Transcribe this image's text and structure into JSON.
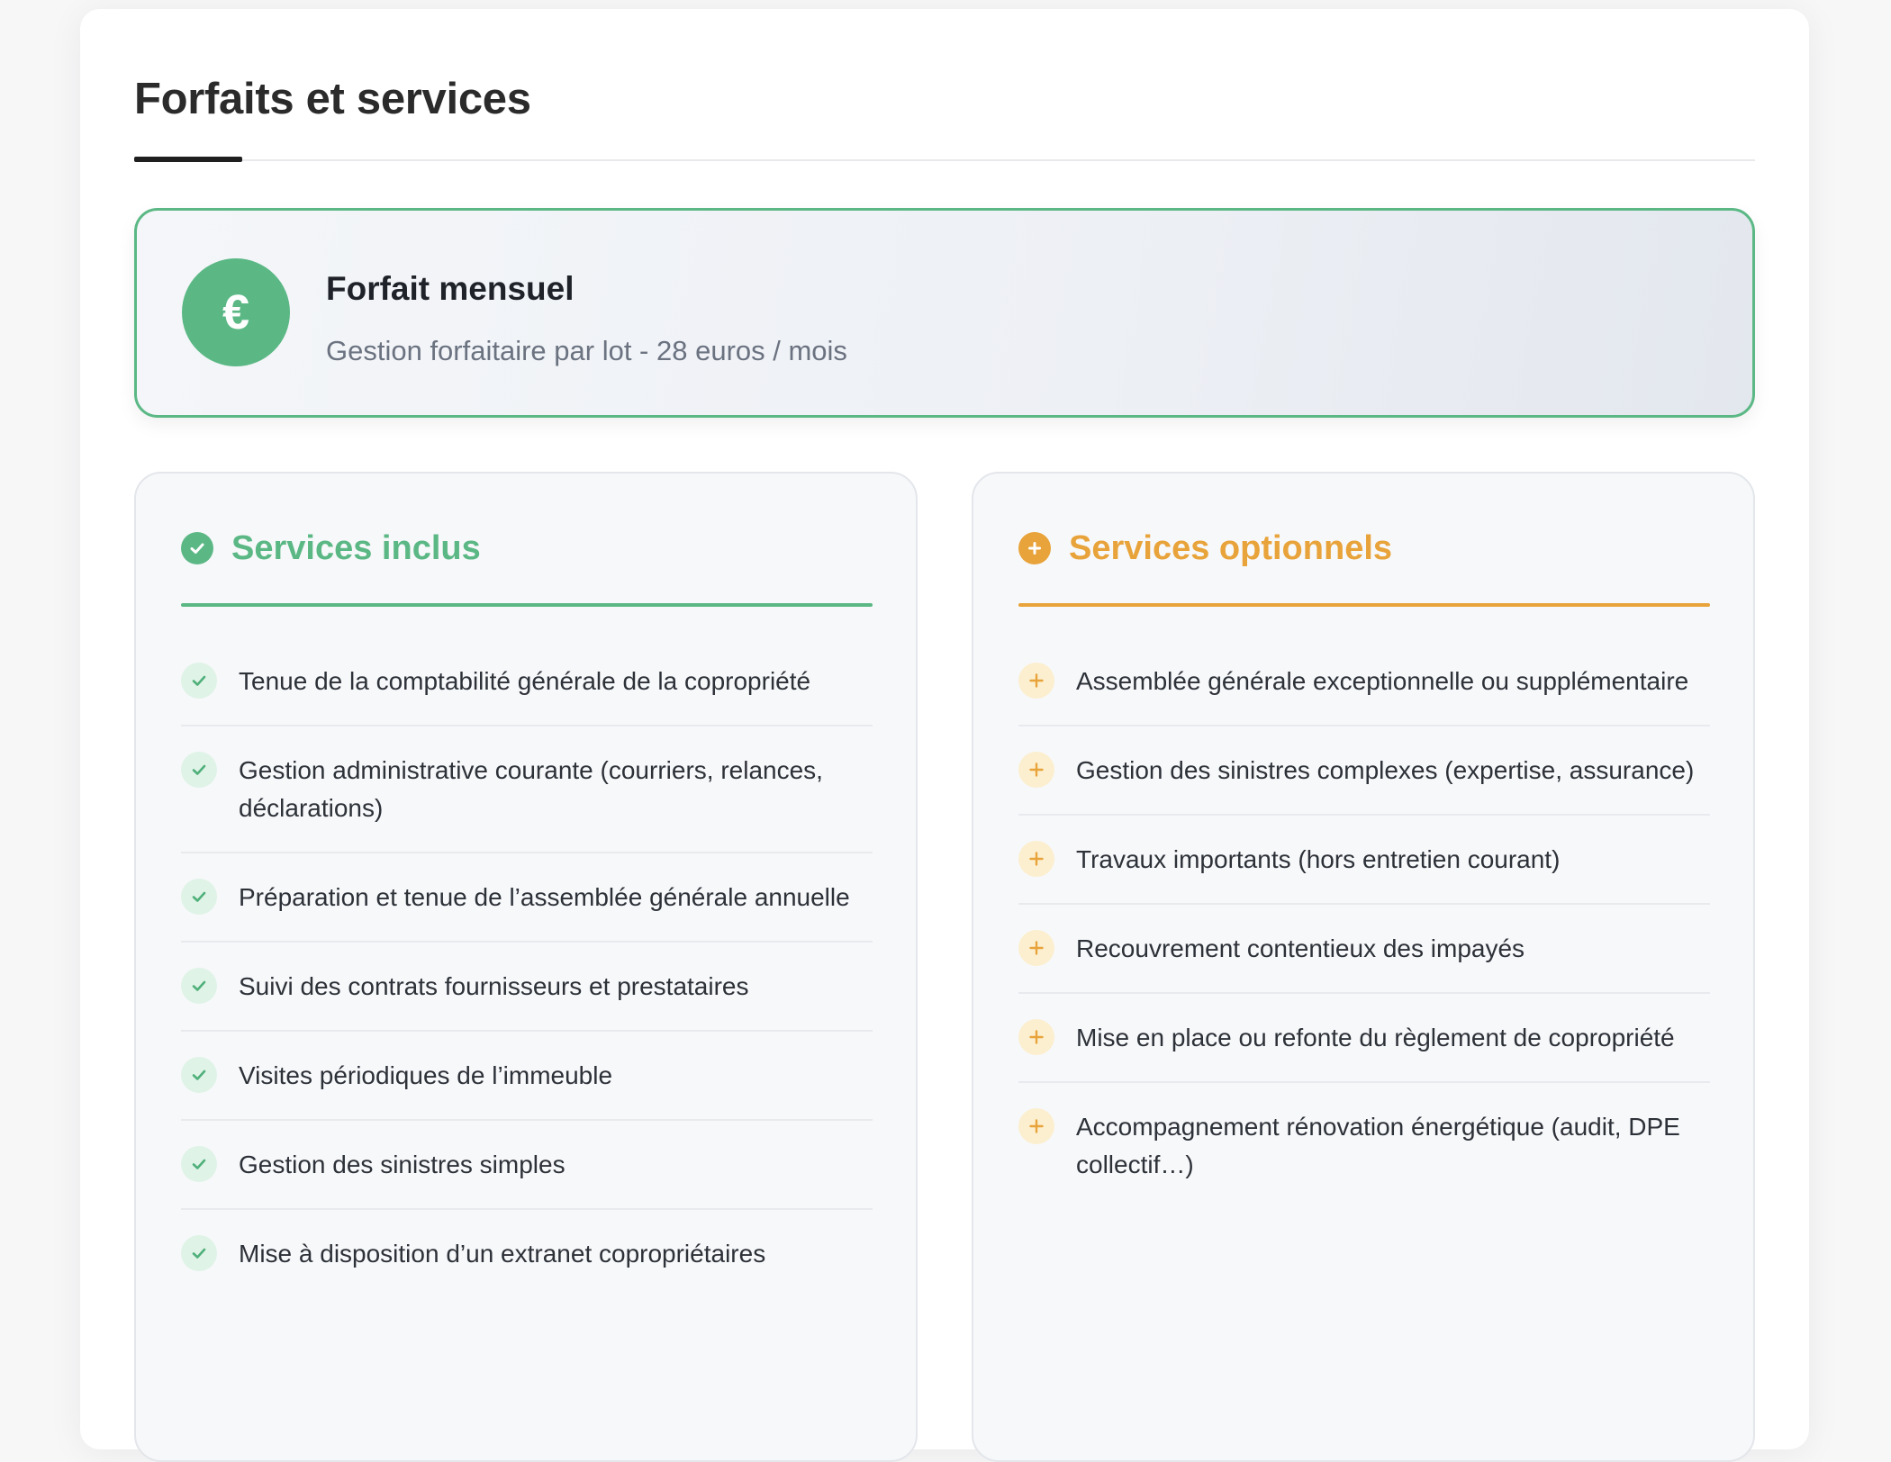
{
  "page": {
    "title": "Forfaits et services"
  },
  "forfait": {
    "icon": "euro-icon",
    "symbol": "€",
    "title": "Forfait mensuel",
    "subtitle": "Gestion forfaitaire par lot - 28 euros / mois",
    "accent_color": "#5bb885"
  },
  "included": {
    "icon": "check-circle-icon",
    "title": "Services inclus",
    "color": "#5bb885",
    "items": [
      {
        "icon": "check-icon",
        "label": "Tenue de la comptabilité générale de la copropriété"
      },
      {
        "icon": "check-icon",
        "label": "Gestion administrative courante (courriers, relances, déclarations)"
      },
      {
        "icon": "check-icon",
        "label": "Préparation et tenue de l’assemblée générale annuelle"
      },
      {
        "icon": "check-icon",
        "label": "Suivi des contrats fournisseurs et prestataires"
      },
      {
        "icon": "check-icon",
        "label": "Visites périodiques de l’immeuble"
      },
      {
        "icon": "check-icon",
        "label": "Gestion des sinistres simples"
      },
      {
        "icon": "check-icon",
        "label": "Mise à disposition d’un extranet copropriétaires"
      }
    ]
  },
  "optional": {
    "icon": "plus-circle-icon",
    "title": "Services optionnels",
    "color": "#e8a33a",
    "items": [
      {
        "icon": "plus-icon",
        "label": "Assemblée générale exceptionnelle ou supplémentaire"
      },
      {
        "icon": "plus-icon",
        "label": "Gestion des sinistres complexes (expertise, assurance)"
      },
      {
        "icon": "plus-icon",
        "label": "Travaux importants (hors entretien courant)"
      },
      {
        "icon": "plus-icon",
        "label": "Recouvrement contentieux des impayés"
      },
      {
        "icon": "plus-icon",
        "label": "Mise en place ou refonte du règlement de copropriété"
      },
      {
        "icon": "plus-icon",
        "label": "Accompagnement rénovation énergétique (audit, DPE collectif…)"
      }
    ]
  }
}
